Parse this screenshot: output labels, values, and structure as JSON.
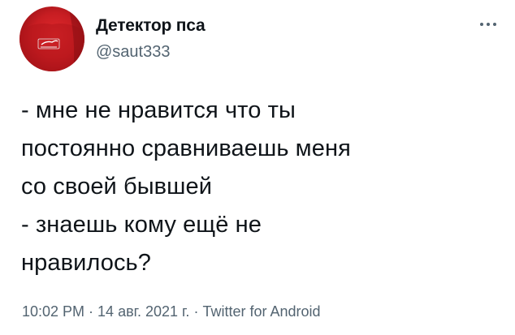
{
  "author": {
    "display_name": "Детектор пса",
    "handle": "@saut333"
  },
  "tweet": {
    "lines": [
      "- мне не нравится что ты",
      "постоянно сравниваешь меня",
      "со своей бывшей",
      "- знаешь кому ещё не",
      "нравилось?"
    ]
  },
  "meta": {
    "time": "10:02 PM",
    "separator": "·",
    "date": "14 авг. 2021 г.",
    "client": "Twitter for Android"
  },
  "icons": {
    "more": "more-dots-icon",
    "avatar": "avatar-image"
  },
  "colors": {
    "text_primary": "#0f1419",
    "text_secondary": "#536471",
    "avatar_red": "#c71d22"
  }
}
